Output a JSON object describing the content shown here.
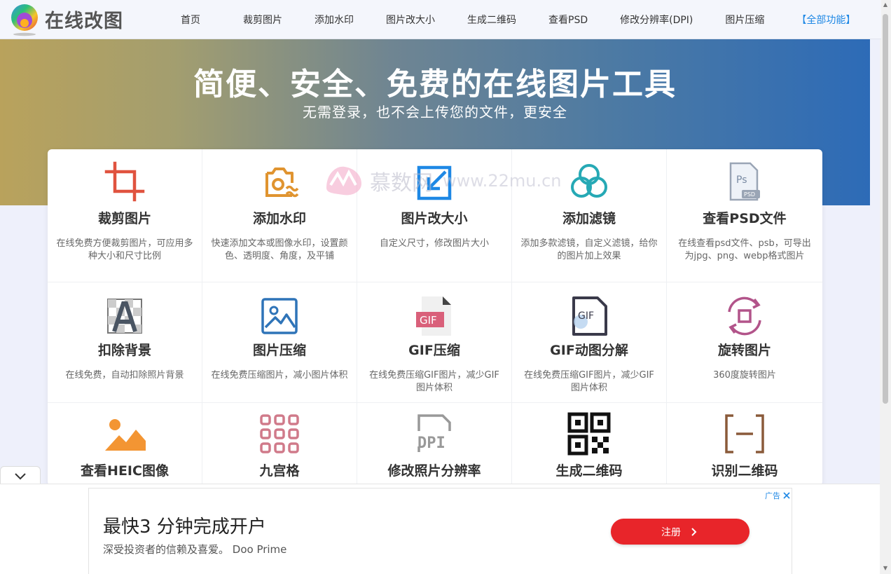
{
  "header": {
    "logo_text": "在线改图",
    "nav": [
      {
        "label": "首页"
      },
      {
        "label": "裁剪图片"
      },
      {
        "label": "添加水印"
      },
      {
        "label": "图片改大小"
      },
      {
        "label": "生成二维码"
      },
      {
        "label": "查看PSD"
      },
      {
        "label": "修改分辨率(DPI)"
      },
      {
        "label": "图片压缩"
      },
      {
        "label": "【全部功能】"
      }
    ]
  },
  "hero": {
    "title": "简便、安全、免费的在线图片工具",
    "subtitle": "无需登录，也不会上传您的文件，更安全"
  },
  "watermark": {
    "text": "慕数网",
    "url": "www.22mu.cn"
  },
  "tools": [
    {
      "title": "裁剪图片",
      "desc": "在线免费方便裁剪图片，可应用多种大小和尺寸比例",
      "icon": "crop-icon"
    },
    {
      "title": "添加水印",
      "desc": "快速添加文本或图像水印，设置颜色、透明度、角度，及平铺",
      "icon": "watermark-icon"
    },
    {
      "title": "图片改大小",
      "desc": "自定义尺寸，修改图片大小",
      "icon": "resize-icon"
    },
    {
      "title": "添加滤镜",
      "desc": "添加多款滤镜，自定义滤镜，给你的图片加上效果",
      "icon": "filter-icon"
    },
    {
      "title": "查看PSD文件",
      "desc": "在线查看psd文件、psb，可导出为jpg、png、webp格式图片",
      "icon": "psd-icon"
    },
    {
      "title": "扣除背景",
      "desc": "在线免费，自动扣除照片背景",
      "icon": "remove-bg-icon"
    },
    {
      "title": "图片压缩",
      "desc": "在线免费压缩图片，减小图片体积",
      "icon": "image-compress-icon"
    },
    {
      "title": "GIF压缩",
      "desc": "在线免费压缩GIF图片，减少GIF图片体积",
      "icon": "gif-compress-icon"
    },
    {
      "title": "GIF动图分解",
      "desc": "在线免费压缩GIF图片，减少GIF图片体积",
      "icon": "gif-split-icon"
    },
    {
      "title": "旋转图片",
      "desc": "360度旋转图片",
      "icon": "rotate-icon"
    },
    {
      "title": "查看HEIC图像",
      "desc": "",
      "icon": "heic-icon"
    },
    {
      "title": "九宫格",
      "desc": "",
      "icon": "grid-nine-icon"
    },
    {
      "title": "修改照片分辨率",
      "desc": "",
      "icon": "dpi-icon"
    },
    {
      "title": "生成二维码",
      "desc": "",
      "icon": "qrcode-icon"
    },
    {
      "title": "识别二维码",
      "desc": "",
      "icon": "scan-qrcode-icon"
    }
  ],
  "ad": {
    "title": "最快3 分钟完成开户",
    "desc": "深受投资者的信赖及喜爱。 Doo Prime",
    "button": "注册",
    "badge": "广告"
  },
  "colors": {
    "accent_blue": "#1e88e5",
    "ad_red": "#e8252a",
    "crop_red": "#e0533f",
    "watermark_orange": "#e09430",
    "filter_teal": "#26a9b5",
    "rotate_purple": "#b2548a",
    "dpi_gray": "#8a8a8a",
    "scan_brown": "#8a5a3a"
  }
}
